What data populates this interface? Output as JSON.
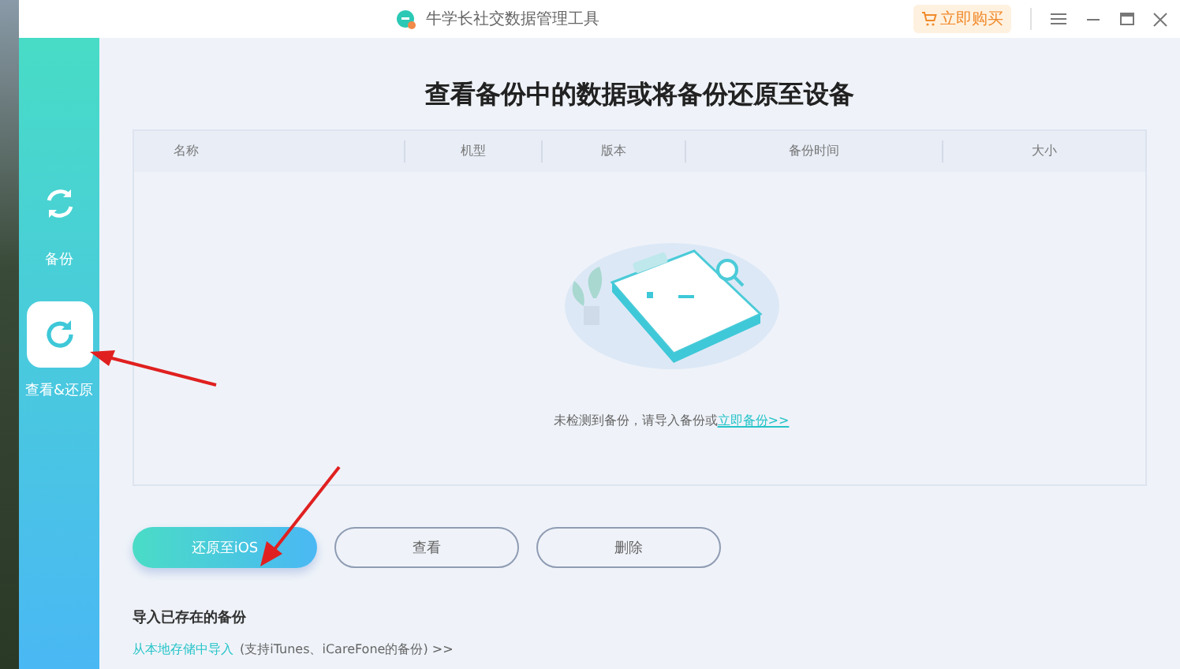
{
  "window": {
    "title": "牛学长社交数据管理工具",
    "buy_button": "立即购买"
  },
  "sidebar": {
    "items": [
      {
        "label": "备份",
        "selected": false
      },
      {
        "label": "查看&还原",
        "selected": true
      }
    ]
  },
  "heading": "查看备份中的数据或将备份还原至设备",
  "table": {
    "columns": [
      "名称",
      "机型",
      "版本",
      "备份时间",
      "大小"
    ],
    "empty_text": "未检测到备份，请导入备份或",
    "empty_link": "立即备份>>"
  },
  "buttons": [
    {
      "label": "还原至iOS",
      "kind": "primary"
    },
    {
      "label": "查看",
      "kind": "outline"
    },
    {
      "label": "删除",
      "kind": "outline"
    }
  ],
  "import": {
    "title": "导入已存在的备份",
    "link": "从本地存储中导入",
    "note": "(支持iTunes、iCareFone的备份) >>"
  }
}
